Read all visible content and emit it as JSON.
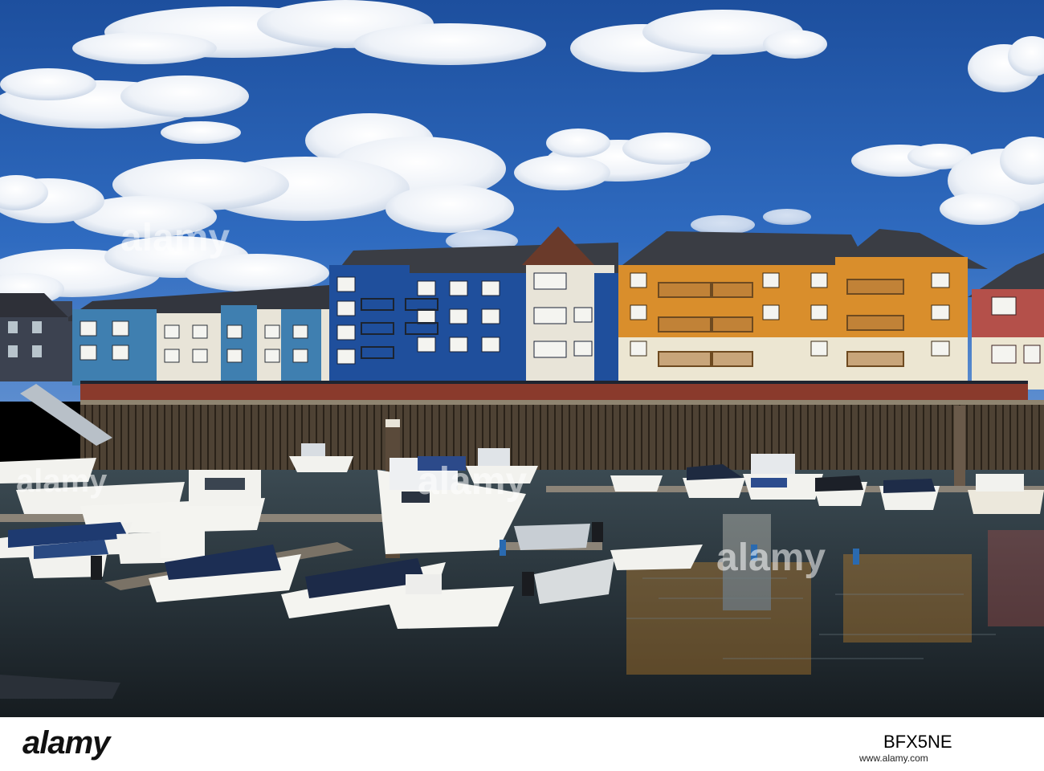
{
  "photo": {
    "subject": "marina-with-waterfront-apartments",
    "colors": {
      "sky": "#2b62b5",
      "water": "#2a3a44",
      "blue_building": "#1f4f9c",
      "teal_building": "#3f7fb0",
      "orange_building": "#d98e2c",
      "red_building": "#b4504a",
      "roof": "#3a3d44",
      "quay_wall": "#4a4038",
      "brick": "#8a3a2c"
    }
  },
  "watermarks": {
    "left": "alamy",
    "center": "alamy",
    "right": "alamy",
    "low": "alamy"
  },
  "stock_bar": {
    "logo_text": "alamy",
    "image_id": "BFX5NE",
    "url": "www.alamy.com"
  }
}
